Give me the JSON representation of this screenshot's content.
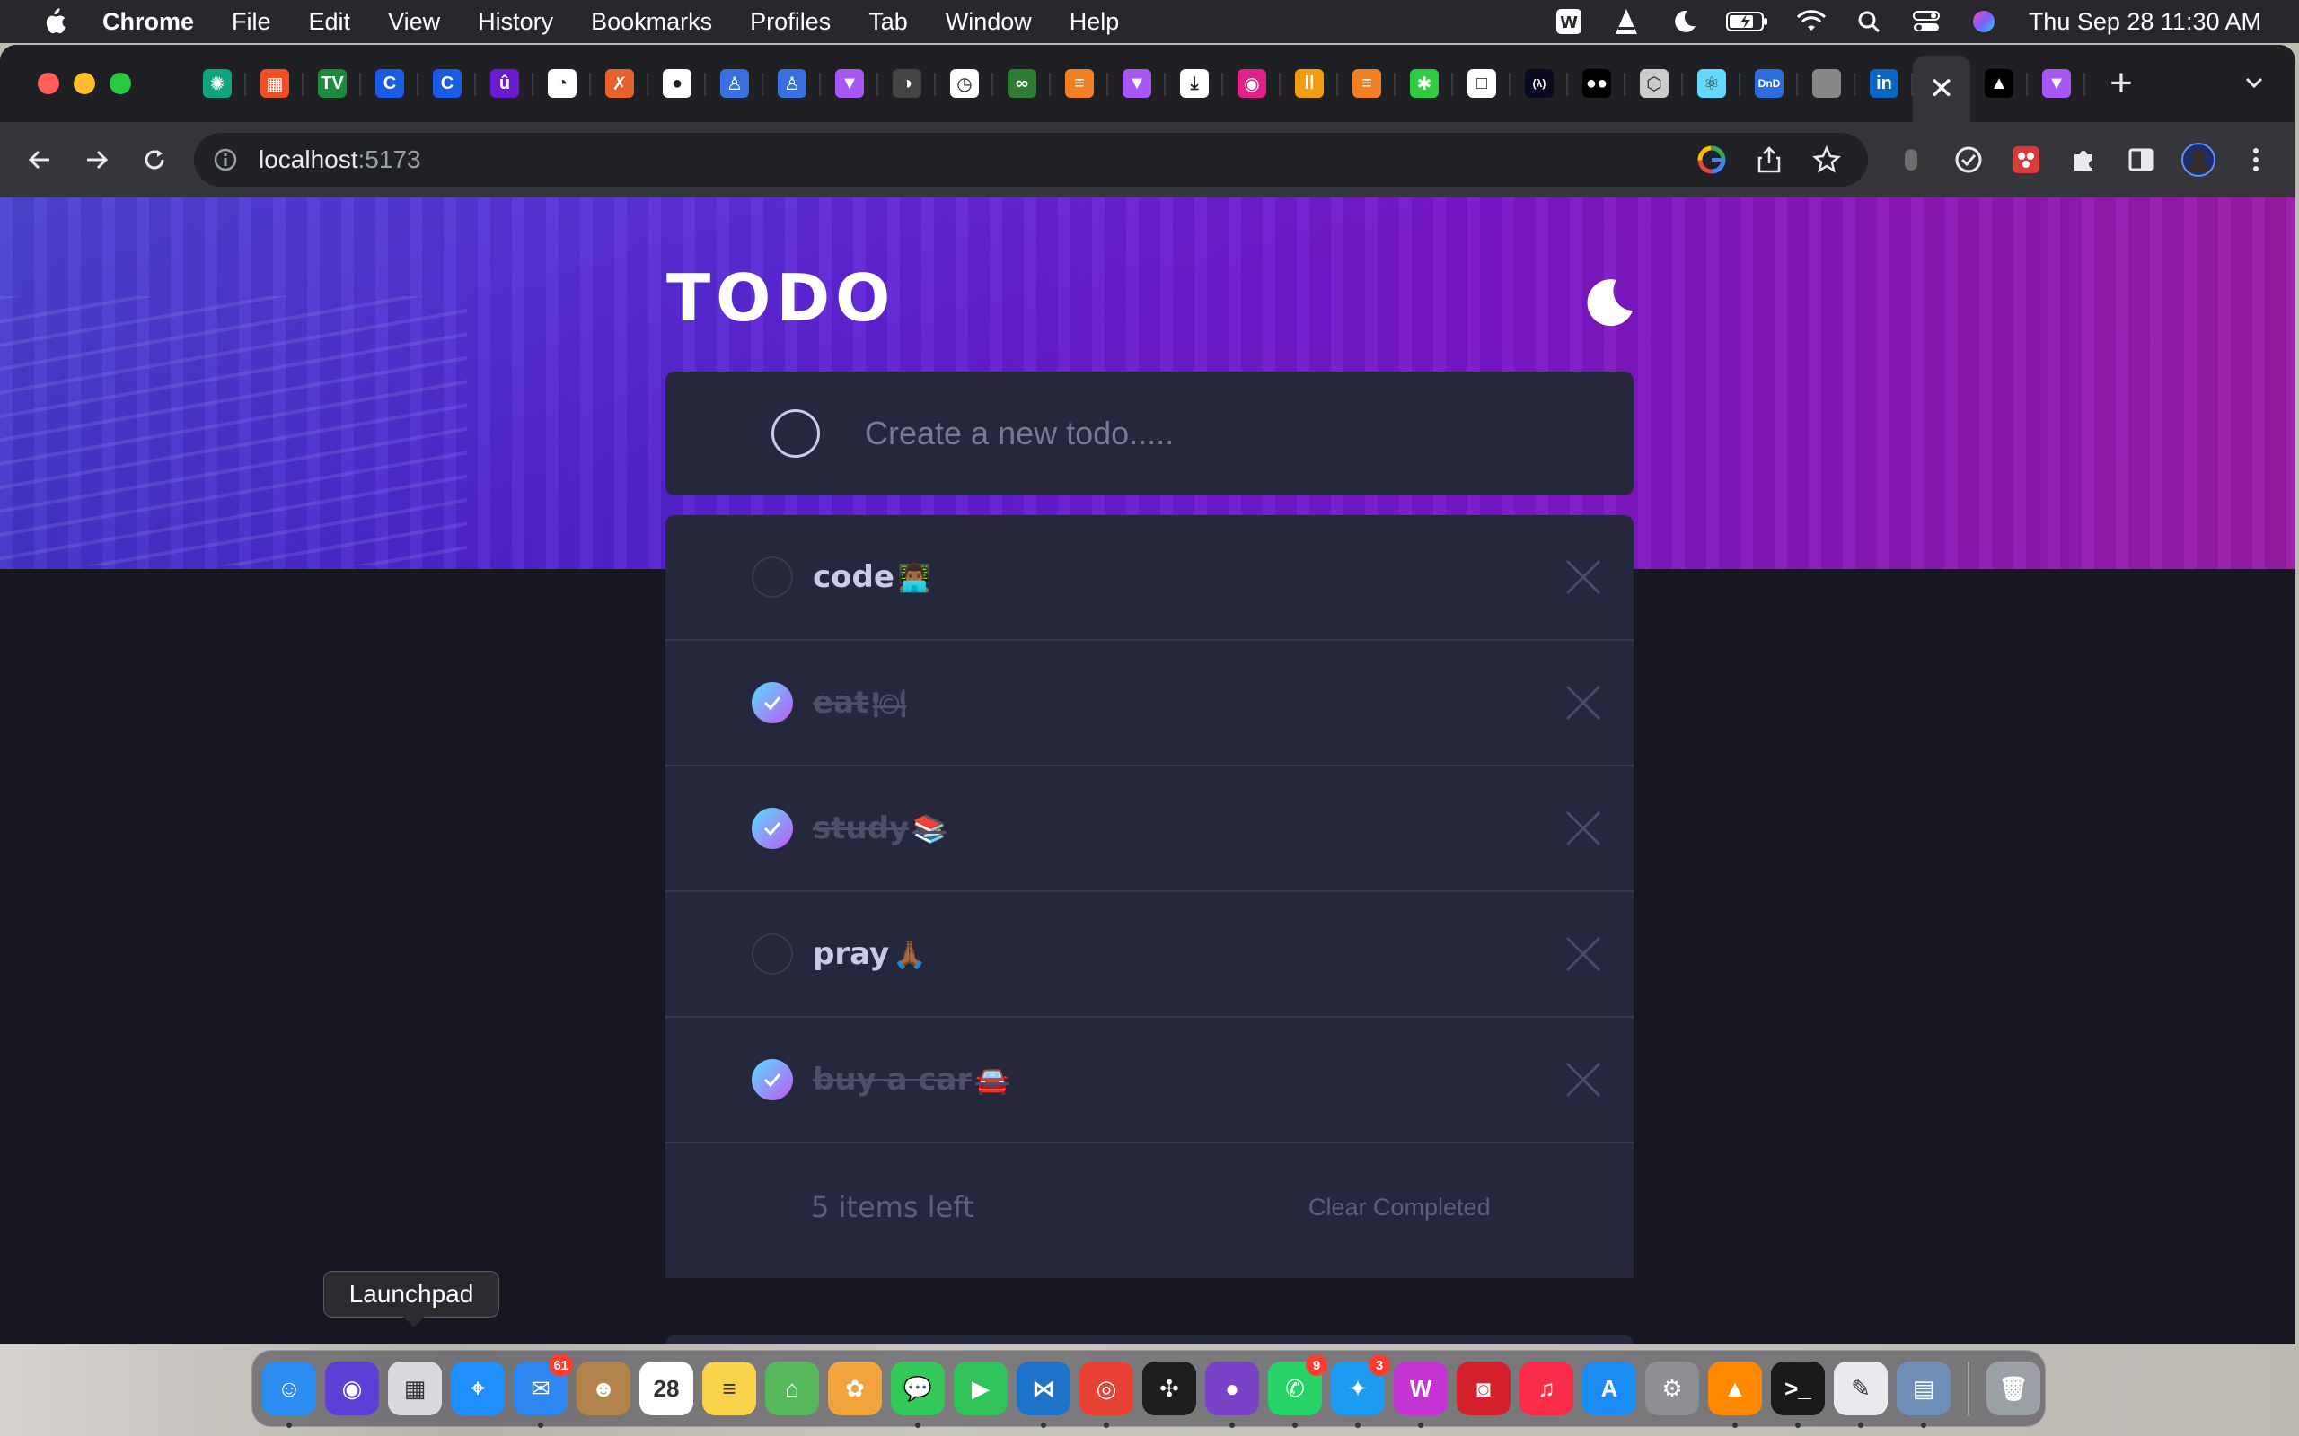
{
  "menubar": {
    "app_name": "Chrome",
    "items": [
      "File",
      "Edit",
      "View",
      "History",
      "Bookmarks",
      "Profiles",
      "Tab",
      "Window",
      "Help"
    ],
    "clock": "Thu Sep 28  11:30 AM",
    "status_icons": [
      "wps-icon",
      "vlc-icon",
      "moon-icon",
      "battery-icon",
      "wifi-icon",
      "search-icon",
      "control-center-icon",
      "siri-icon"
    ]
  },
  "browser": {
    "tabs": [
      {
        "icon": "chatgpt-icon",
        "glyph": "✺",
        "color": "#10a37f"
      },
      {
        "icon": "microsoft-icon",
        "glyph": "▦",
        "color": "#f25022"
      },
      {
        "icon": "tradingview-icon",
        "glyph": "TV",
        "color": "#1c8a3a"
      },
      {
        "icon": "coinmarketcap-icon",
        "glyph": "C",
        "color": "#1a5be8"
      },
      {
        "icon": "coinmarketcap-icon",
        "glyph": "C",
        "color": "#1a5be8"
      },
      {
        "icon": "upwork-icon",
        "glyph": "û",
        "color": "#6a1bd1"
      },
      {
        "icon": "document-icon",
        "glyph": "◔",
        "color": "#ffffff"
      },
      {
        "icon": "figma-community-icon",
        "glyph": "✗",
        "color": "#e5622d"
      },
      {
        "icon": "github-icon",
        "glyph": "●",
        "color": "#ffffff"
      },
      {
        "icon": "profile-icon",
        "glyph": "♙",
        "color": "#3b6fe0"
      },
      {
        "icon": "profile-icon",
        "glyph": "♙",
        "color": "#3b6fe0"
      },
      {
        "icon": "vite-icon",
        "glyph": "▼",
        "color": "#a855f7"
      },
      {
        "icon": "speed-icon",
        "glyph": "◑",
        "color": "#444444"
      },
      {
        "icon": "clock-icon",
        "glyph": "◷",
        "color": "#ffffff"
      },
      {
        "icon": "link-icon",
        "glyph": "∞",
        "color": "#2e7d32"
      },
      {
        "icon": "stackoverflow-icon",
        "glyph": "≡",
        "color": "#f48024"
      },
      {
        "icon": "vite-icon",
        "glyph": "▼",
        "color": "#a855f7"
      },
      {
        "icon": "download-icon",
        "glyph": "⤓",
        "color": "#ffffff"
      },
      {
        "icon": "camera-icon",
        "glyph": "◉",
        "color": "#e0218a"
      },
      {
        "icon": "chart-icon",
        "glyph": "ǀǀ",
        "color": "#f39c12"
      },
      {
        "icon": "stackoverflow-icon",
        "glyph": "≡",
        "color": "#f48024"
      },
      {
        "icon": "asterisk-icon",
        "glyph": "✱",
        "color": "#2ecc40"
      },
      {
        "icon": "square-icon",
        "glyph": "□",
        "color": "#ffffff"
      },
      {
        "icon": "freecodecamp-icon",
        "glyph": "(λ)",
        "color": "#0a0a23"
      },
      {
        "icon": "medium-icon",
        "glyph": "●●",
        "color": "#000000"
      },
      {
        "icon": "cube-icon",
        "glyph": "⬡",
        "color": "#cccccc"
      },
      {
        "icon": "react-icon",
        "glyph": "⚛",
        "color": "#61dafb"
      },
      {
        "icon": "dnd-icon",
        "glyph": "DnD",
        "color": "#2d6cdf"
      },
      {
        "icon": "apple-icon",
        "glyph": "",
        "color": "#888888"
      },
      {
        "icon": "linkedin-icon",
        "glyph": "in",
        "color": "#0a66c2"
      },
      {
        "icon": "close-icon",
        "glyph": "✕",
        "color": "#e8eaed",
        "active": true
      },
      {
        "icon": "vercel-icon",
        "glyph": "▲",
        "color": "#000000"
      },
      {
        "icon": "vite-icon",
        "glyph": "▼",
        "color": "#a855f7"
      }
    ],
    "url_host": "localhost",
    "url_port": ":5173"
  },
  "app": {
    "title": "TODO",
    "input_placeholder": "Create a new todo.....",
    "todos": [
      {
        "label": "code",
        "emoji": "👨🏾‍💻",
        "completed": false
      },
      {
        "label": "eat",
        "emoji": "🍽",
        "completed": true
      },
      {
        "label": "study",
        "emoji": "📚",
        "completed": true
      },
      {
        "label": "pray",
        "emoji": "🙏🏾",
        "completed": false
      },
      {
        "label": "buy a car",
        "emoji": "🚘",
        "completed": true
      }
    ],
    "items_left": "5 items left",
    "clear_completed": "Clear Completed"
  },
  "dock": {
    "tooltip": "Launchpad",
    "apps": [
      {
        "name": "finder-icon",
        "color": "#2b8cf2",
        "glyph": "☺",
        "running": true
      },
      {
        "name": "siri-icon",
        "color": "#5b3fd6",
        "glyph": "◉",
        "running": false
      },
      {
        "name": "launchpad-icon",
        "color": "#d9d9de",
        "glyph": "▦",
        "running": false
      },
      {
        "name": "safari-icon",
        "color": "#1e90ff",
        "glyph": "⌖",
        "running": false
      },
      {
        "name": "mail-icon",
        "color": "#2e87f0",
        "glyph": "✉",
        "badge": "61",
        "running": true
      },
      {
        "name": "contacts-icon",
        "color": "#b3834c",
        "glyph": "☻",
        "running": false
      },
      {
        "name": "calendar-icon",
        "color": "#ffffff",
        "glyph": "28",
        "running": false
      },
      {
        "name": "notes-icon",
        "color": "#f8d34a",
        "glyph": "≡",
        "running": false
      },
      {
        "name": "maps-icon",
        "color": "#56b85a",
        "glyph": "⌂",
        "running": false
      },
      {
        "name": "photos-icon",
        "color": "#f2a33a",
        "glyph": "✿",
        "running": false
      },
      {
        "name": "messages-icon",
        "color": "#34c759",
        "glyph": "💬",
        "running": true
      },
      {
        "name": "facetime-icon",
        "color": "#2fc35a",
        "glyph": "▶",
        "running": false
      },
      {
        "name": "vscode-icon",
        "color": "#1e73c8",
        "glyph": "⋈",
        "running": true
      },
      {
        "name": "chrome-icon",
        "color": "#e94235",
        "glyph": "◎",
        "running": true
      },
      {
        "name": "figma-icon",
        "color": "#1e1e1e",
        "glyph": "✣",
        "running": false
      },
      {
        "name": "github-desktop-icon",
        "color": "#7a42c6",
        "glyph": "●",
        "running": true
      },
      {
        "name": "whatsapp-icon",
        "color": "#25d366",
        "glyph": "✆",
        "badge": "9",
        "running": true
      },
      {
        "name": "twitter-icon",
        "color": "#1d9bf0",
        "glyph": "✦",
        "badge": "3",
        "running": true
      },
      {
        "name": "wps-icon",
        "color": "#c535d4",
        "glyph": "W",
        "running": true
      },
      {
        "name": "photobooth-icon",
        "color": "#d3202c",
        "glyph": "◙",
        "running": false
      },
      {
        "name": "music-icon",
        "color": "#fa2d48",
        "glyph": "♫",
        "running": false
      },
      {
        "name": "appstore-icon",
        "color": "#1b8cf4",
        "glyph": "A",
        "running": false
      },
      {
        "name": "system-settings-icon",
        "color": "#8e8e93",
        "glyph": "⚙",
        "running": false
      },
      {
        "name": "vlc-icon",
        "color": "#ff8800",
        "glyph": "▲",
        "running": true
      },
      {
        "name": "terminal-icon",
        "color": "#1a1a1a",
        "glyph": ">_",
        "running": true
      },
      {
        "name": "textedit-icon",
        "color": "#e9e9ee",
        "glyph": "✎",
        "running": true
      },
      {
        "name": "preview-icon",
        "color": "#6f8fb8",
        "glyph": "▤",
        "running": true
      }
    ],
    "trash": {
      "name": "trash-icon",
      "color": "#9aa0a6",
      "glyph": "🗑"
    }
  }
}
